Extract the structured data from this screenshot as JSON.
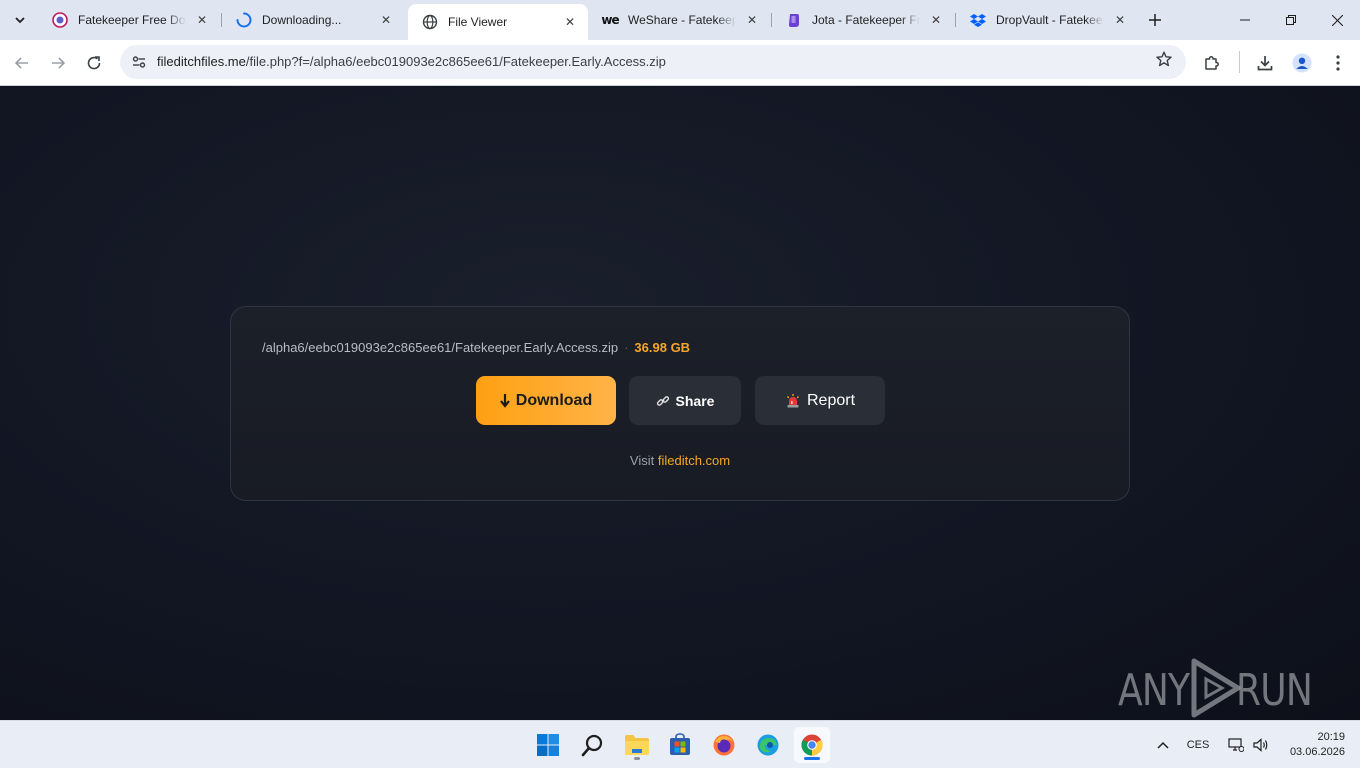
{
  "tabs": [
    {
      "title": "Fatekeeper Free Download",
      "icon": "rg-logo-icon",
      "active": false
    },
    {
      "title": "Downloading...",
      "icon": "loading-spinner-icon",
      "active": false
    },
    {
      "title": "File Viewer",
      "icon": "globe-icon",
      "active": true
    },
    {
      "title": "WeShare - Fatekeeper",
      "icon": "weshare-logo-icon",
      "active": false
    },
    {
      "title": "Jota - Fatekeeper Free",
      "icon": "jota-logo-icon",
      "active": false
    },
    {
      "title": "DropVault - Fatekeeper",
      "icon": "dropbox-logo-icon",
      "active": false
    }
  ],
  "address": {
    "host": "fileditchfiles.me",
    "path": "/file.php?f=/alpha6/eebc019093e2c865ee61/Fatekeeper.Early.Access.zip"
  },
  "file": {
    "path": "/alpha6/eebc019093e2c865ee61/Fatekeeper.Early.Access.zip",
    "separator": "·",
    "size": "36.98 GB"
  },
  "buttons": {
    "download": "Download",
    "share": "Share",
    "report": "Report"
  },
  "visit": {
    "prefix": "Visit",
    "link": "fileditch.com"
  },
  "watermark": {
    "left": "ANY",
    "right": "RUN"
  },
  "tray": {
    "language": "CES",
    "time": "20:19",
    "date": "03.06.2026"
  },
  "colors": {
    "accent": "#f7a625",
    "page_background": "#121623",
    "card_background": "#1c2029"
  }
}
